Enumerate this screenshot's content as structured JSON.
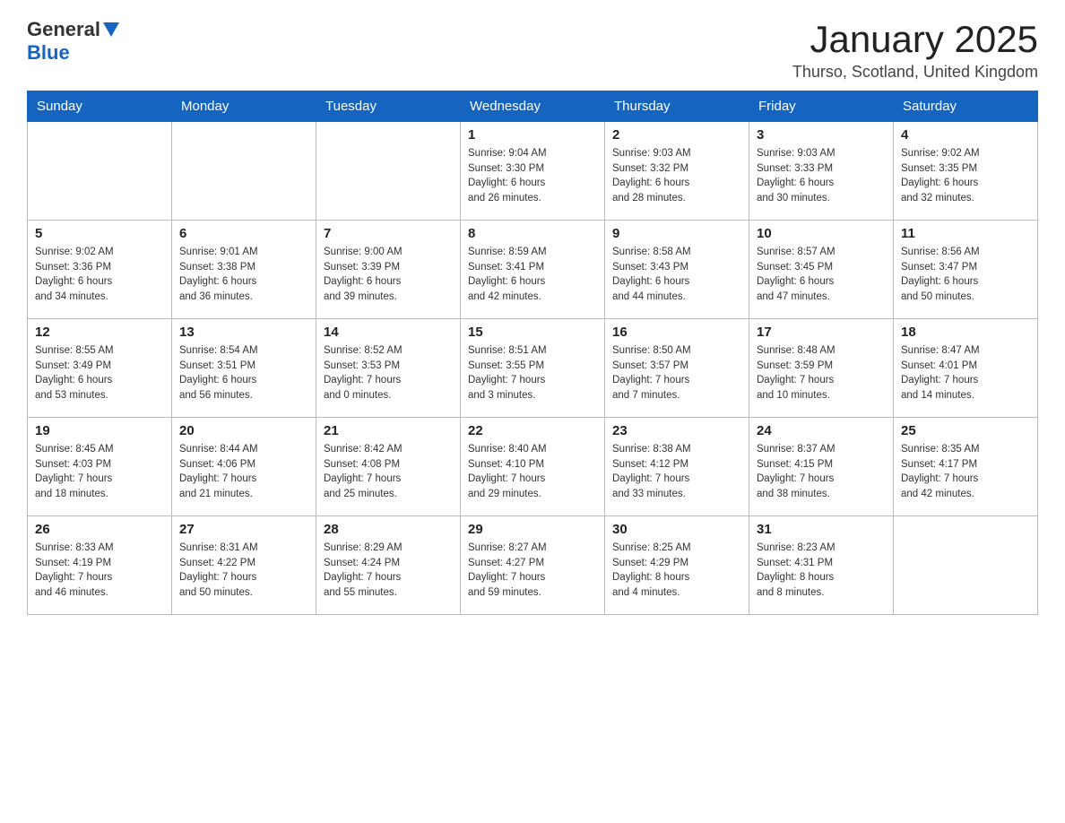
{
  "header": {
    "logo_general": "General",
    "logo_blue": "Blue",
    "month_title": "January 2025",
    "location": "Thurso, Scotland, United Kingdom"
  },
  "weekdays": [
    "Sunday",
    "Monday",
    "Tuesday",
    "Wednesday",
    "Thursday",
    "Friday",
    "Saturday"
  ],
  "weeks": [
    [
      {
        "day": "",
        "info": ""
      },
      {
        "day": "",
        "info": ""
      },
      {
        "day": "",
        "info": ""
      },
      {
        "day": "1",
        "info": "Sunrise: 9:04 AM\nSunset: 3:30 PM\nDaylight: 6 hours\nand 26 minutes."
      },
      {
        "day": "2",
        "info": "Sunrise: 9:03 AM\nSunset: 3:32 PM\nDaylight: 6 hours\nand 28 minutes."
      },
      {
        "day": "3",
        "info": "Sunrise: 9:03 AM\nSunset: 3:33 PM\nDaylight: 6 hours\nand 30 minutes."
      },
      {
        "day": "4",
        "info": "Sunrise: 9:02 AM\nSunset: 3:35 PM\nDaylight: 6 hours\nand 32 minutes."
      }
    ],
    [
      {
        "day": "5",
        "info": "Sunrise: 9:02 AM\nSunset: 3:36 PM\nDaylight: 6 hours\nand 34 minutes."
      },
      {
        "day": "6",
        "info": "Sunrise: 9:01 AM\nSunset: 3:38 PM\nDaylight: 6 hours\nand 36 minutes."
      },
      {
        "day": "7",
        "info": "Sunrise: 9:00 AM\nSunset: 3:39 PM\nDaylight: 6 hours\nand 39 minutes."
      },
      {
        "day": "8",
        "info": "Sunrise: 8:59 AM\nSunset: 3:41 PM\nDaylight: 6 hours\nand 42 minutes."
      },
      {
        "day": "9",
        "info": "Sunrise: 8:58 AM\nSunset: 3:43 PM\nDaylight: 6 hours\nand 44 minutes."
      },
      {
        "day": "10",
        "info": "Sunrise: 8:57 AM\nSunset: 3:45 PM\nDaylight: 6 hours\nand 47 minutes."
      },
      {
        "day": "11",
        "info": "Sunrise: 8:56 AM\nSunset: 3:47 PM\nDaylight: 6 hours\nand 50 minutes."
      }
    ],
    [
      {
        "day": "12",
        "info": "Sunrise: 8:55 AM\nSunset: 3:49 PM\nDaylight: 6 hours\nand 53 minutes."
      },
      {
        "day": "13",
        "info": "Sunrise: 8:54 AM\nSunset: 3:51 PM\nDaylight: 6 hours\nand 56 minutes."
      },
      {
        "day": "14",
        "info": "Sunrise: 8:52 AM\nSunset: 3:53 PM\nDaylight: 7 hours\nand 0 minutes."
      },
      {
        "day": "15",
        "info": "Sunrise: 8:51 AM\nSunset: 3:55 PM\nDaylight: 7 hours\nand 3 minutes."
      },
      {
        "day": "16",
        "info": "Sunrise: 8:50 AM\nSunset: 3:57 PM\nDaylight: 7 hours\nand 7 minutes."
      },
      {
        "day": "17",
        "info": "Sunrise: 8:48 AM\nSunset: 3:59 PM\nDaylight: 7 hours\nand 10 minutes."
      },
      {
        "day": "18",
        "info": "Sunrise: 8:47 AM\nSunset: 4:01 PM\nDaylight: 7 hours\nand 14 minutes."
      }
    ],
    [
      {
        "day": "19",
        "info": "Sunrise: 8:45 AM\nSunset: 4:03 PM\nDaylight: 7 hours\nand 18 minutes."
      },
      {
        "day": "20",
        "info": "Sunrise: 8:44 AM\nSunset: 4:06 PM\nDaylight: 7 hours\nand 21 minutes."
      },
      {
        "day": "21",
        "info": "Sunrise: 8:42 AM\nSunset: 4:08 PM\nDaylight: 7 hours\nand 25 minutes."
      },
      {
        "day": "22",
        "info": "Sunrise: 8:40 AM\nSunset: 4:10 PM\nDaylight: 7 hours\nand 29 minutes."
      },
      {
        "day": "23",
        "info": "Sunrise: 8:38 AM\nSunset: 4:12 PM\nDaylight: 7 hours\nand 33 minutes."
      },
      {
        "day": "24",
        "info": "Sunrise: 8:37 AM\nSunset: 4:15 PM\nDaylight: 7 hours\nand 38 minutes."
      },
      {
        "day": "25",
        "info": "Sunrise: 8:35 AM\nSunset: 4:17 PM\nDaylight: 7 hours\nand 42 minutes."
      }
    ],
    [
      {
        "day": "26",
        "info": "Sunrise: 8:33 AM\nSunset: 4:19 PM\nDaylight: 7 hours\nand 46 minutes."
      },
      {
        "day": "27",
        "info": "Sunrise: 8:31 AM\nSunset: 4:22 PM\nDaylight: 7 hours\nand 50 minutes."
      },
      {
        "day": "28",
        "info": "Sunrise: 8:29 AM\nSunset: 4:24 PM\nDaylight: 7 hours\nand 55 minutes."
      },
      {
        "day": "29",
        "info": "Sunrise: 8:27 AM\nSunset: 4:27 PM\nDaylight: 7 hours\nand 59 minutes."
      },
      {
        "day": "30",
        "info": "Sunrise: 8:25 AM\nSunset: 4:29 PM\nDaylight: 8 hours\nand 4 minutes."
      },
      {
        "day": "31",
        "info": "Sunrise: 8:23 AM\nSunset: 4:31 PM\nDaylight: 8 hours\nand 8 minutes."
      },
      {
        "day": "",
        "info": ""
      }
    ]
  ]
}
